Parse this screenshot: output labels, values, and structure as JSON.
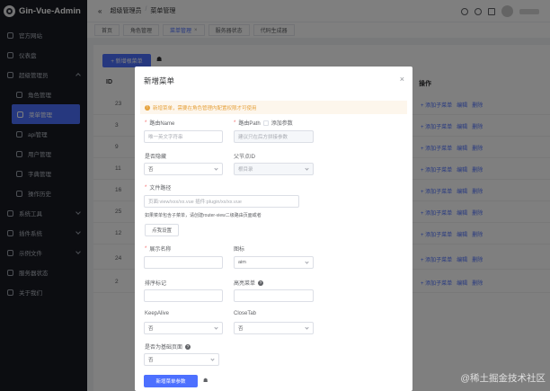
{
  "app": {
    "title": "Gin-Vue-Admin"
  },
  "sidebar": {
    "items": [
      {
        "label": "官方网站"
      },
      {
        "label": "仪表盘"
      },
      {
        "label": "超级管理员"
      },
      {
        "label": "角色管理"
      },
      {
        "label": "菜单管理"
      },
      {
        "label": "api管理"
      },
      {
        "label": "用户管理"
      },
      {
        "label": "字典管理"
      },
      {
        "label": "操作历史"
      },
      {
        "label": "系统工具"
      },
      {
        "label": "插件系统"
      },
      {
        "label": "示例文件"
      },
      {
        "label": "服务器状态"
      },
      {
        "label": "关于我们"
      }
    ]
  },
  "header": {
    "breadcrumb": [
      "超级管理员",
      "菜单管理"
    ],
    "separator": "/",
    "collapse_icon": "«"
  },
  "tabs": [
    {
      "label": "首页"
    },
    {
      "label": "角色管理"
    },
    {
      "label": "菜单管理",
      "active": true
    },
    {
      "label": "服务器状态"
    },
    {
      "label": "代码生成器"
    }
  ],
  "main": {
    "add_root_button": "+ 新增根菜单",
    "columns": {
      "id": "ID",
      "ops": "操作"
    },
    "rows": [
      {
        "id": "23"
      },
      {
        "id": "3"
      },
      {
        "id": "9"
      },
      {
        "id": "11"
      },
      {
        "id": "16"
      },
      {
        "id": "25"
      },
      {
        "id": "12"
      },
      {
        "id": "24"
      },
      {
        "id": "2"
      }
    ],
    "row_ops": {
      "add_child": "+ 添加子菜单",
      "edit": "编辑",
      "delete": "删除"
    }
  },
  "dialog": {
    "title": "新增菜单",
    "close": "×",
    "warning": "新增菜单，需要在角色管理内配置权限才可使用",
    "route_name": {
      "label": "路由Name",
      "placeholder": "唯一英文字符串"
    },
    "route_path": {
      "label": "路由Path",
      "add_param": "添加参数",
      "placeholder": "建议只在后方拼接参数"
    },
    "hidden": {
      "label": "是否隐藏",
      "value": "否"
    },
    "parent": {
      "label": "父节点ID",
      "value": "根目录"
    },
    "component": {
      "label": "文件路径",
      "placeholder": "页面:view/xxx/xx.vue 插件:plugin/xx/xx.vue",
      "hint": "如果菜单包含子菜单，请创建router-view二级路由页面或者",
      "button": "点我设置"
    },
    "display_name": {
      "label": "展示名称",
      "value": ""
    },
    "icon": {
      "label": "图标",
      "value": "aim"
    },
    "sort": {
      "label": "排序标记",
      "value": ""
    },
    "active_menu": {
      "label": "高亮菜单",
      "value": ""
    },
    "keep_alive": {
      "label": "KeepAlive",
      "value": "否"
    },
    "close_tab": {
      "label": "CloseTab",
      "value": "否"
    },
    "base_page": {
      "label": "是否为基础页面",
      "value": "否"
    },
    "menu_param_button": "新增菜单参数"
  },
  "watermark": "@稀土掘金技术社区"
}
